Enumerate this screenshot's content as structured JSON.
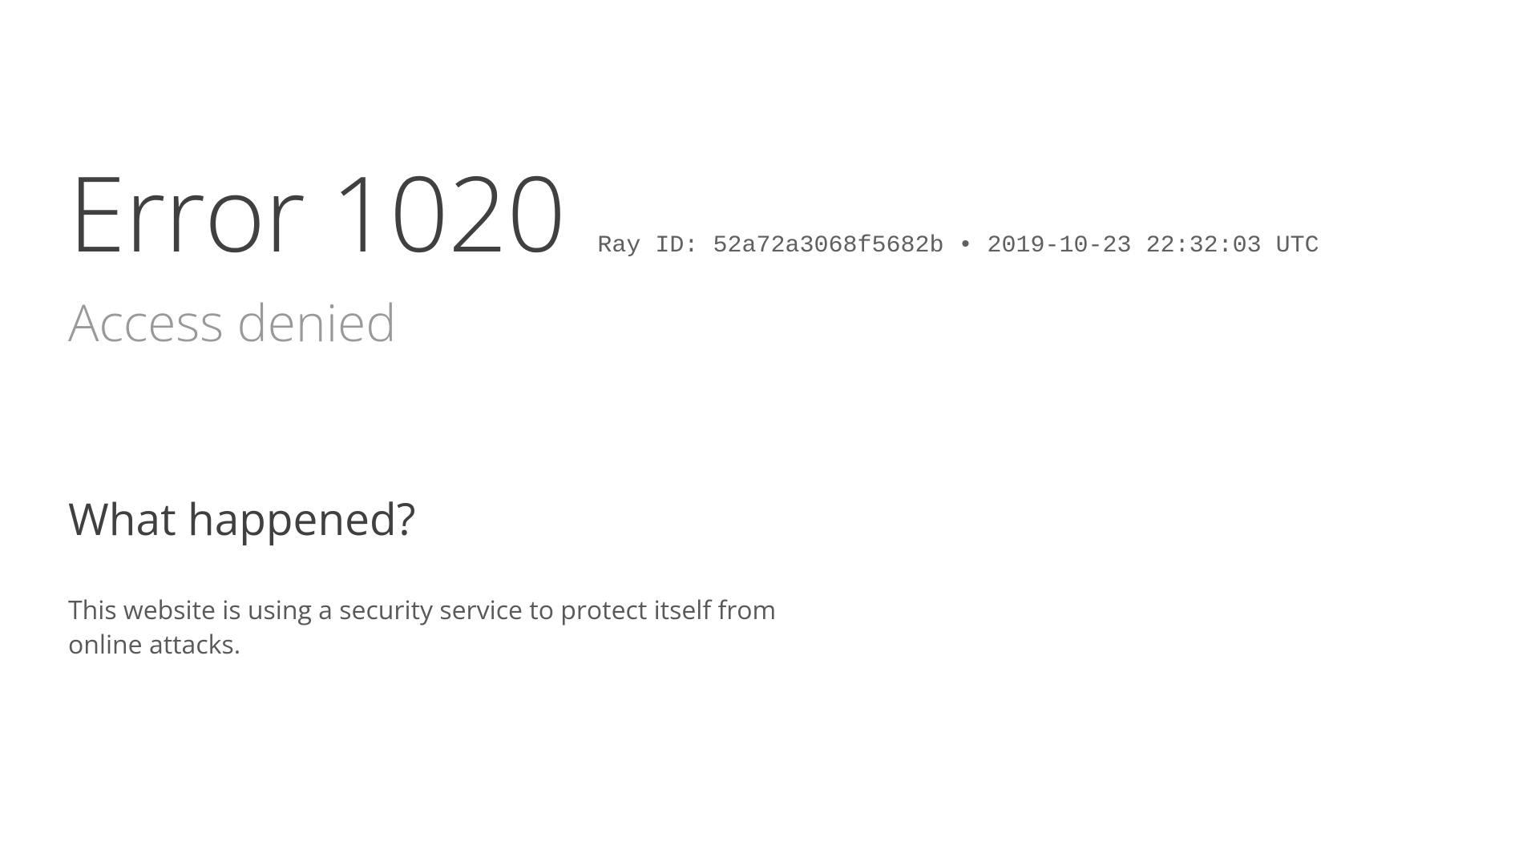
{
  "error": {
    "title": "Error 1020",
    "ray_label": "Ray ID:",
    "ray_id": "52a72a3068f5682b",
    "separator": "•",
    "timestamp": "2019-10-23 22:32:03 UTC",
    "subtitle": "Access denied"
  },
  "section": {
    "heading": "What happened?",
    "body": "This website is using a security service to protect itself from online attacks."
  }
}
